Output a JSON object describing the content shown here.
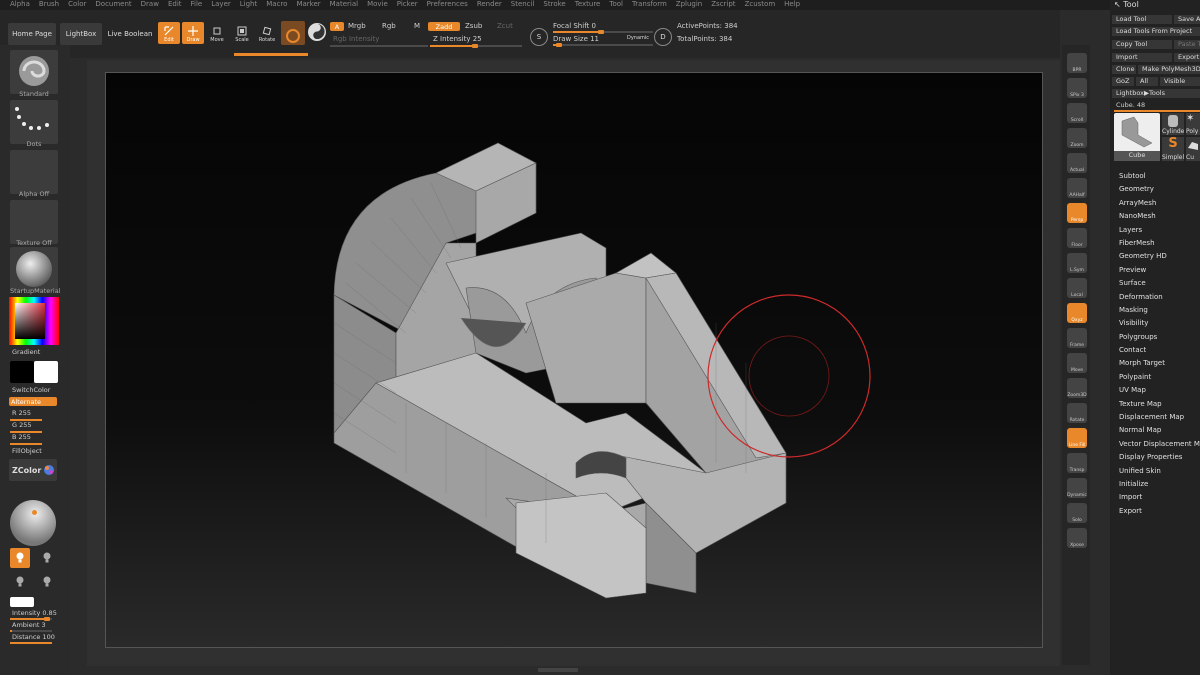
{
  "menu": [
    "Alpha",
    "Brush",
    "Color",
    "Document",
    "Draw",
    "Edit",
    "File",
    "Layer",
    "Light",
    "Macro",
    "Marker",
    "Material",
    "Movie",
    "Picker",
    "Preferences",
    "Render",
    "Stencil",
    "Stroke",
    "Texture",
    "Tool",
    "Transform",
    "Zplugin",
    "Zscript",
    "Zcustom",
    "Help"
  ],
  "toolbar": {
    "home": "Home Page",
    "lightbox": "LightBox",
    "live_boolean": "Live Boolean",
    "edit": "Edit",
    "draw": "Draw",
    "move": "Move",
    "scale": "Scale",
    "rotate": "Rotate",
    "a": "A",
    "mrgb": "Mrgb",
    "rgb": "Rgb",
    "m": "M",
    "zadd": "Zadd",
    "zsub": "Zsub",
    "zcut": "Zcut",
    "rgb_intensity": "Rgb Intensity",
    "z_intensity": "Z Intensity 25",
    "focal_shift": "Focal Shift 0",
    "draw_size": "Draw Size 11",
    "dynamic": "Dynamic",
    "active_points": "ActivePoints: 384",
    "total_points": "TotalPoints: 384",
    "s": "S",
    "d": "D"
  },
  "left": {
    "brush": "Standard",
    "stroke": "Dots",
    "alpha": "Alpha Off",
    "texture": "Texture Off",
    "material": "StartupMaterial",
    "gradient": "Gradient",
    "switch_color": "SwitchColor",
    "alternate": "Alternate",
    "r": "R 255",
    "g": "G 255",
    "b": "B 255",
    "fill": "FillObject",
    "zcolor": "ZColor",
    "intensity": "Intensity 0.85",
    "ambient": "Ambient 3",
    "distance": "Distance 100"
  },
  "right_tools": [
    "BPR",
    "SPix 3",
    "Scroll",
    "Zoom",
    "Actual",
    "AAHalf",
    "Persp",
    "Floor",
    "L.Sym",
    "Local",
    "Qxyz",
    "Frame",
    "Move",
    "Zoom3D",
    "Rotate",
    "Line Fill",
    "Transp",
    "Dynamic",
    "Solo",
    "Xpose"
  ],
  "tool_panel": {
    "title": "Tool",
    "load_tool": "Load Tool",
    "save_as": "Save As",
    "load_project": "Load Tools From Project",
    "copy_tool": "Copy Tool",
    "paste_tool": "Paste Tool",
    "import": "Import",
    "export": "Export",
    "clone": "Clone",
    "make_polymesh": "Make PolyMesh3D",
    "goz": "GoZ",
    "all": "All",
    "visible": "Visible",
    "lightbox_tools": "Lightbox▶Tools",
    "cube_label": "Cube. 48",
    "thumb_cube": "Cube",
    "thumb_cylinder": "Cylinde",
    "thumb_poly": "Poly",
    "thumb_simple": "Simplel",
    "thumb_cu": "Cu",
    "sections": [
      "Subtool",
      "Geometry",
      "ArrayMesh",
      "NanoMesh",
      "Layers",
      "FiberMesh",
      "Geometry HD",
      "Preview",
      "Surface",
      "Deformation",
      "Masking",
      "Visibility",
      "Polygroups",
      "Contact",
      "Morph Target",
      "Polypaint",
      "UV Map",
      "Texture Map",
      "Displacement Map",
      "Normal Map",
      "Vector Displacement Map",
      "Display Properties",
      "Unified Skin",
      "Initialize",
      "Import",
      "Export"
    ]
  },
  "colors": {
    "accent": "#e8882a",
    "brush_circle": "#cc2a2a"
  }
}
